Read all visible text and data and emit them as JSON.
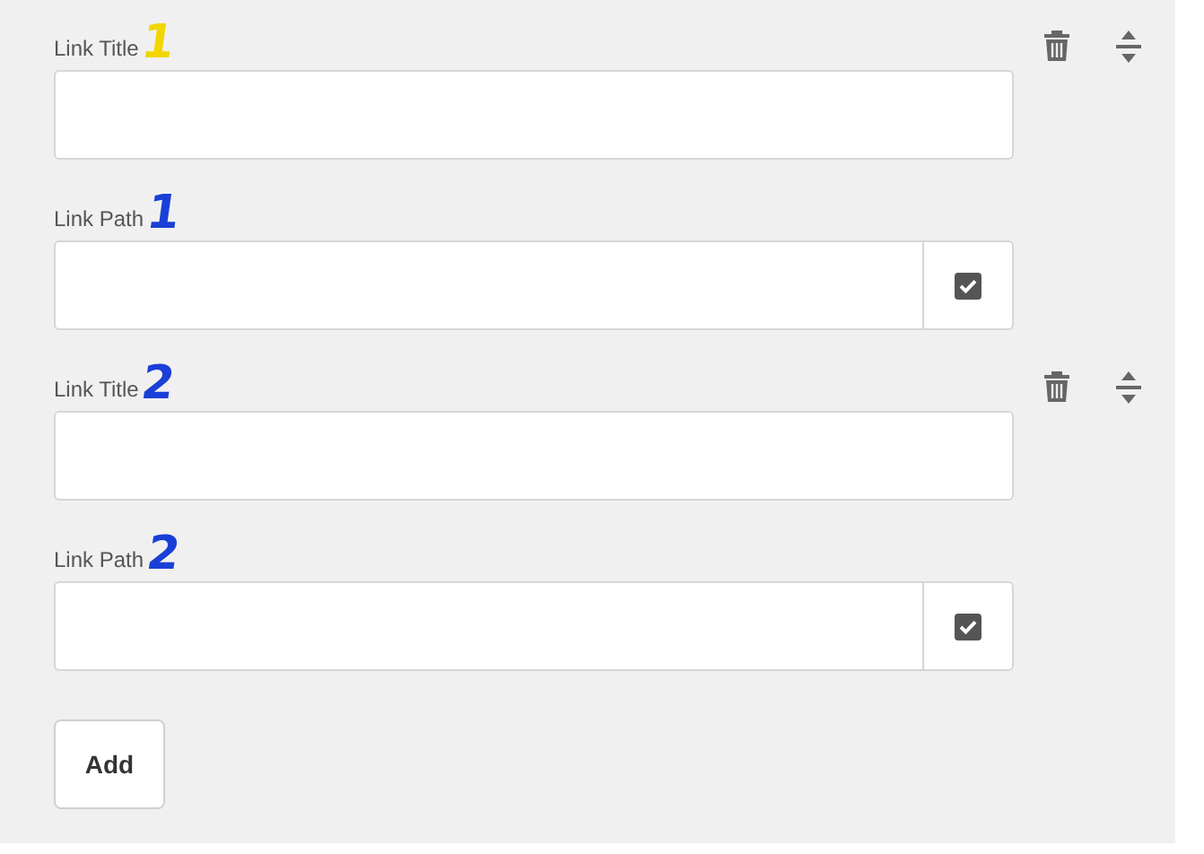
{
  "links": [
    {
      "title_field": {
        "label": "Link Title",
        "annotation": {
          "text": "1",
          "color": "#f2d600"
        }
      },
      "path_field": {
        "label": "Link Path",
        "annotation": {
          "text": "1",
          "color": "#1a3fd6"
        },
        "checked": true
      }
    },
    {
      "title_field": {
        "label": "Link Title",
        "annotation": {
          "text": "2",
          "color": "#1a3fd6"
        }
      },
      "path_field": {
        "label": "Link Path",
        "annotation": {
          "text": "2",
          "color": "#1a3fd6"
        },
        "checked": true
      }
    }
  ],
  "add_button": "Add"
}
